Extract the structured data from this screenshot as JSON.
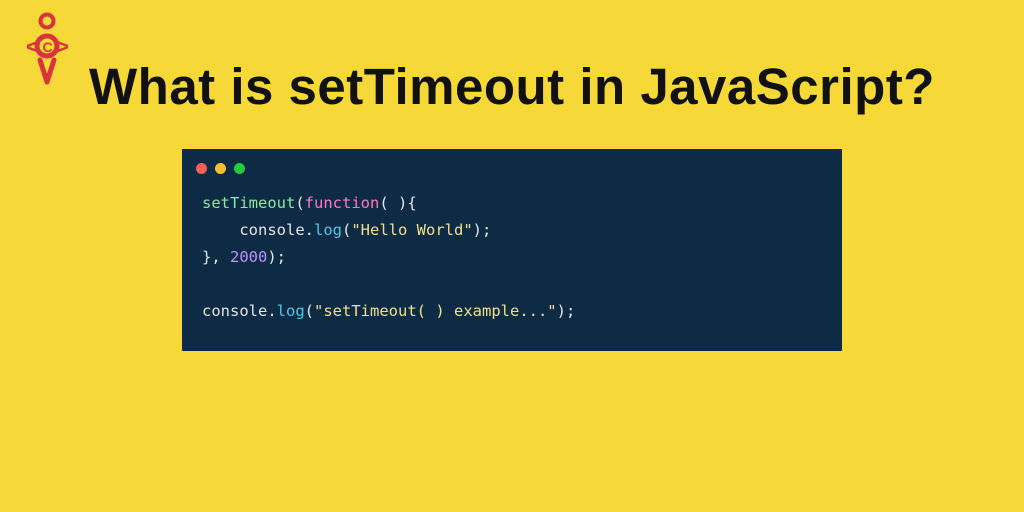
{
  "title": "What is setTimeout in JavaScript?",
  "logo_name": "oca-logo",
  "code": {
    "line1": {
      "fn": "setTimeout",
      "open": "(",
      "kw": "function",
      "parens": "( ){"
    },
    "line2": {
      "indent": "    ",
      "obj": "console",
      "dot": ".",
      "method": "log",
      "open": "(",
      "str": "\"Hello World\"",
      "close": ");"
    },
    "line3": {
      "brace": "}, ",
      "num": "2000",
      "close": ");"
    },
    "line5": {
      "obj": "console",
      "dot": ".",
      "method": "log",
      "open": "(",
      "str": "\"setTimeout( ) example...\"",
      "close": ");"
    }
  }
}
